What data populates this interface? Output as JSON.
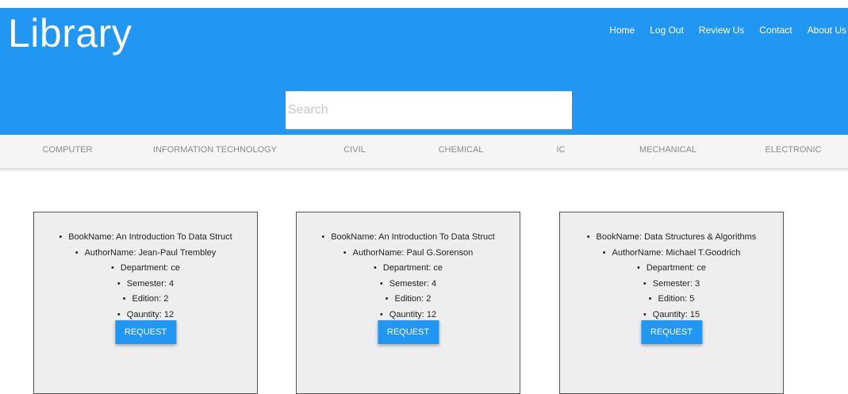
{
  "header": {
    "title": "Library",
    "nav": [
      "Home",
      "Log Out",
      "Review Us",
      "Contact",
      "About Us"
    ]
  },
  "search": {
    "placeholder": "Search",
    "value": ""
  },
  "categories": [
    "COMPUTER",
    "INFORMATION TECHNOLOGY",
    "CIVIL",
    "CHEMICAL",
    "IC",
    "MECHANICAL",
    "ELECTRONIC"
  ],
  "books": [
    {
      "name": "BookName: An Introduction To Data Struct",
      "author": "AuthorName: Jean-Paul Trembley",
      "department": "Department: ce",
      "semester": "Semester: 4",
      "edition": "Edition: 2",
      "quantity": "Qauntity: 12",
      "button": "REQUEST"
    },
    {
      "name": "BookName: An Introduction To Data Struct",
      "author": "AuthorName: Paul G.Sorenson",
      "department": "Department: ce",
      "semester": "Semester: 4",
      "edition": "Edition: 2",
      "quantity": "Qauntity: 12",
      "button": "REQUEST"
    },
    {
      "name": "BookName: Data Structures & Algorithms",
      "author": "AuthorName: Michael T.Goodrich",
      "department": "Department: ce",
      "semester": "Semester: 3",
      "edition": "Edition: 5",
      "quantity": "Qauntity: 15",
      "button": "REQUEST"
    }
  ],
  "colors": {
    "primary": "#2196f3",
    "card_bg": "#eeeeee",
    "category_text": "#8a8a8a"
  }
}
